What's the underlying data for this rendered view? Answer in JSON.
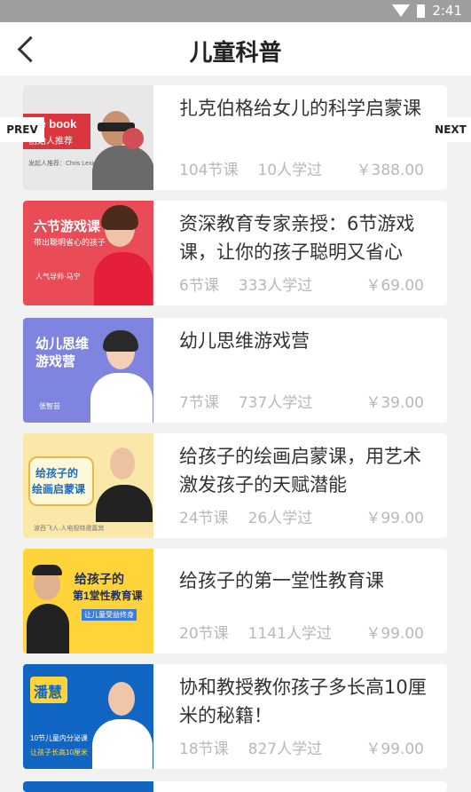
{
  "status": {
    "time": "2:41",
    "wifi_icon": "wifi-icon",
    "battery_icon": "battery-icon"
  },
  "header": {
    "title": "儿童科普",
    "back_icon": "back-chevron-icon"
  },
  "nav": {
    "prev": "PREV",
    "next": "NEXT"
  },
  "courses": [
    {
      "title": "扎克伯格给女儿的科学启蒙课",
      "lessons": "104节课",
      "learners": "10人学过",
      "price": "￥388.00",
      "thumb_text": "ace book",
      "thumb_sub": "创始人推荐",
      "thumb_small": "发起人推荐：Chris Lexie"
    },
    {
      "title": "资深教育专家亲授：6节游戏课，让你的孩子聪明又省心",
      "lessons": "6节课",
      "learners": "333人学过",
      "price": "￥69.00",
      "thumb_text": "六节游戏课",
      "thumb_sub": "带出聪明省心的孩子",
      "thumb_small": "人气导师·马宁"
    },
    {
      "title": "幼儿思维游戏营",
      "lessons": "7节课",
      "learners": "737人学过",
      "price": "￥39.00",
      "thumb_text": "幼儿思维",
      "thumb_sub": "游戏营",
      "thumb_small": "张智芸"
    },
    {
      "title": "给孩子的绘画启蒙课，用艺术激发孩子的天赋潜能",
      "lessons": "24节课",
      "learners": "26人学过",
      "price": "￥99.00",
      "thumb_text": "给孩子的",
      "thumb_sub": "绘画启蒙课",
      "thumb_small": "波西飞人·人电视特邀嘉宾"
    },
    {
      "title": "给孩子的第一堂性教育课",
      "lessons": "20节课",
      "learners": "1141人学过",
      "price": "￥99.00",
      "thumb_text": "给孩子的",
      "thumb_sub": "第1堂性教育课",
      "thumb_small": "让儿童受益终身"
    },
    {
      "title": "协和教授教你孩子多长高10厘米的秘籍！",
      "lessons": "18节课",
      "learners": "827人学过",
      "price": "￥99.00",
      "thumb_text": "潘慧",
      "thumb_sub": "10节儿童内分泌课",
      "thumb_small": "让孩子长高10厘米"
    }
  ]
}
